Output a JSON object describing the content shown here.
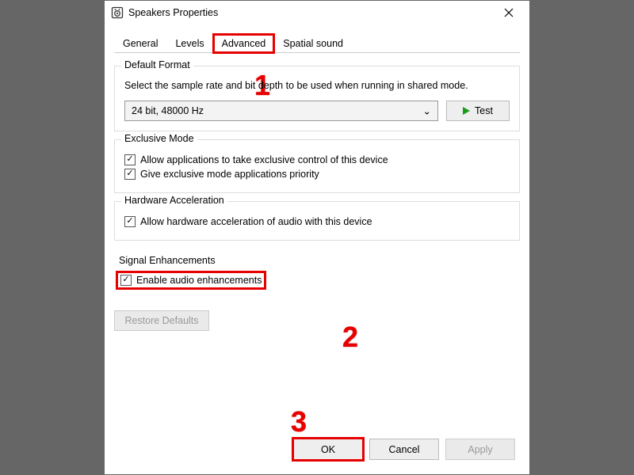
{
  "window": {
    "title": "Speakers Properties"
  },
  "tabs": {
    "general": "General",
    "levels": "Levels",
    "advanced": "Advanced",
    "spatial": "Spatial sound",
    "active": "advanced"
  },
  "default_format": {
    "group_title": "Default Format",
    "description": "Select the sample rate and bit depth to be used when running in shared mode.",
    "selected": "24 bit, 48000 Hz",
    "test_label": "Test"
  },
  "exclusive_mode": {
    "group_title": "Exclusive Mode",
    "chk1_label": "Allow applications to take exclusive control of this device",
    "chk1_checked": true,
    "chk2_label": "Give exclusive mode applications priority",
    "chk2_checked": true
  },
  "hardware_accel": {
    "group_title": "Hardware Acceleration",
    "chk_label": "Allow hardware acceleration of audio with this device",
    "chk_checked": true
  },
  "signal_enh": {
    "group_title": "Signal Enhancements",
    "chk_label": "Enable audio enhancements",
    "chk_checked": true
  },
  "restore_defaults": "Restore Defaults",
  "footer": {
    "ok": "OK",
    "cancel": "Cancel",
    "apply": "Apply"
  },
  "annotations": {
    "one": "1",
    "two": "2",
    "three": "3"
  },
  "checkmark": "✓",
  "chevron": "⌄"
}
